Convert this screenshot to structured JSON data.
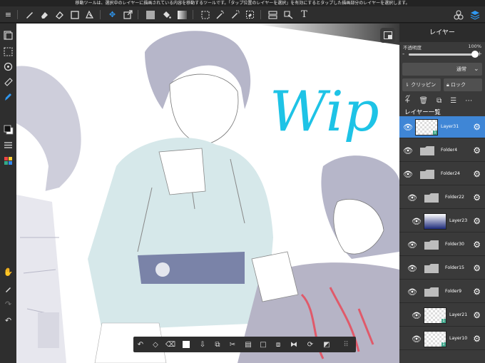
{
  "message_bar": {
    "text": "移動ツールは、選択中のレイヤーに描画されている内容を移動するツールです。「タップ位置のレイヤーを選択」を有効にするとタップした描画部分のレイヤーを選択します。"
  },
  "toolbar": {
    "icons": [
      "menu-icon",
      "brush-icon",
      "eraser-icon",
      "fill-eraser-icon",
      "rectangle-icon",
      "shape-icon",
      "move-icon",
      "transform-icon",
      "color-fill-icon",
      "bucket-icon",
      "gradation-icon",
      "select-rect-icon",
      "magic-wand-icon",
      "select-pen-icon",
      "select-eraser-icon",
      "layout-icon",
      "divide-icon",
      "text-icon",
      "materials-icon",
      "layers-icon"
    ]
  },
  "canvas": {
    "wip_text": "Wip",
    "wip_color": "#1ec3e6"
  },
  "layer_panel": {
    "title": "レイヤー",
    "opacity_label": "不透明度",
    "opacity_value": "100%",
    "opacity_fraction": 1.0,
    "opacity_minus": "-",
    "opacity_plus": "+",
    "blend_mode": "通常",
    "clipping_label": "クリッピング",
    "lock_label": "ロック",
    "list_title": "レイヤー一覧",
    "layers": [
      {
        "name": "Layer31",
        "type": "layer",
        "selected": true,
        "badge": "1"
      },
      {
        "name": "Folder4",
        "type": "folder",
        "selected": false
      },
      {
        "name": "Folder24",
        "type": "folder",
        "selected": false
      },
      {
        "name": "Folder22",
        "type": "folder",
        "selected": false
      },
      {
        "name": "Layer23",
        "type": "layer",
        "selected": false
      },
      {
        "name": "Folder30",
        "type": "folder",
        "selected": false
      },
      {
        "name": "Folder15",
        "type": "folder",
        "selected": false
      },
      {
        "name": "Folder9",
        "type": "folder",
        "selected": false
      },
      {
        "name": "Layer21",
        "type": "layer",
        "selected": false,
        "badge": "1"
      },
      {
        "name": "Layer10",
        "type": "layer",
        "selected": false,
        "badge": "1"
      }
    ]
  },
  "colors": {
    "accent": "#3f86d6",
    "toolbar_bg": "#2e2e2e",
    "panel_bg": "#3a3a3a"
  }
}
